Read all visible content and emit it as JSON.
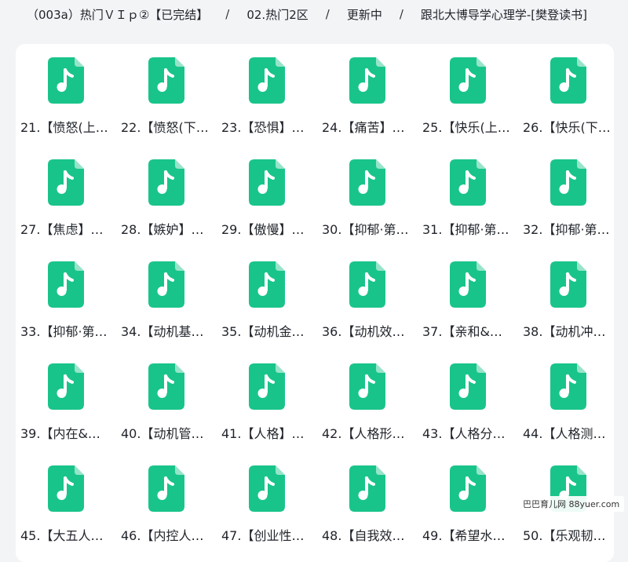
{
  "breadcrumb": [
    "（003a）热门ＶＩｐ②【已完结】",
    "02.热门2区",
    "更新中",
    "跟北大博导学心理学-[樊登读书]"
  ],
  "breadcrumb_separator": "/",
  "icon": {
    "name": "audio-file-icon",
    "color": "#19c48b"
  },
  "files": [
    "21.【愤怒(上…",
    "22.【愤怒(下…",
    "23.【恐惧】…",
    "24.【痛苦】…",
    "25.【快乐(上…",
    "26.【快乐(下…",
    "27.【焦虑】…",
    "28.【嫉妒】…",
    "29.【傲慢】…",
    "30.【抑郁·第…",
    "31.【抑郁·第…",
    "32.【抑郁·第…",
    "33.【抑郁·第…",
    "34.【动机基…",
    "35.【动机金…",
    "36.【动机效…",
    "37.【亲和&…",
    "38.【动机冲…",
    "39.【内在&…",
    "40.【动机管…",
    "41.【人格】…",
    "42.【人格形…",
    "43.【人格分…",
    "44.【人格测…",
    "45.【大五人…",
    "46.【内控人…",
    "47.【创业性…",
    "48.【自我效…",
    "49.【希望水…",
    "50.【乐观韧…"
  ],
  "watermark": "巴巴育儿网 88yuer.com"
}
